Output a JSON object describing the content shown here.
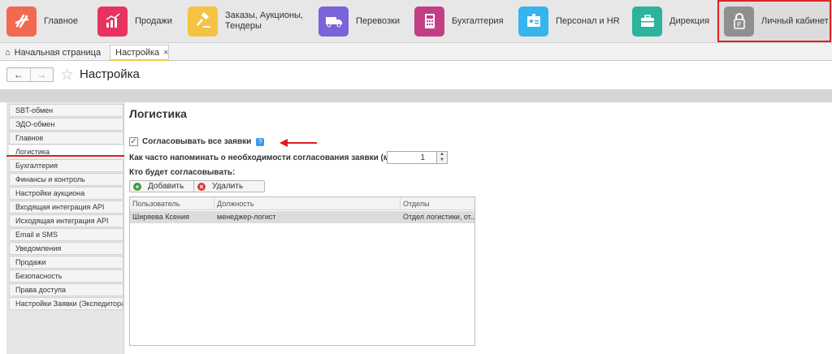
{
  "modules": [
    {
      "label": "Главное",
      "icon": "scribble-logo-icon",
      "color": "#f16a4f"
    },
    {
      "label": "Продажи",
      "icon": "sales-chart-icon",
      "color": "#e8325f"
    },
    {
      "label": "Заказы,  Аукционы,\nТендеры",
      "icon": "gavel-icon",
      "color": "#f5c342"
    },
    {
      "label": "Перевозки",
      "icon": "truck-icon",
      "color": "#7b63d9"
    },
    {
      "label": "Бухгалтерия",
      "icon": "calculator-icon",
      "color": "#c23f86"
    },
    {
      "label": "Персонал и HR",
      "icon": "id-card-icon",
      "color": "#35b4ee"
    },
    {
      "label": "Дирекция",
      "icon": "briefcase-icon",
      "color": "#2eb39a"
    },
    {
      "label": "Личный кабинет",
      "icon": "lock-icon",
      "color": "#8f8f8f"
    }
  ],
  "tabs": {
    "home": "Начальная страница",
    "settings": "Настройка",
    "close": "×"
  },
  "page_title": "Настройка",
  "sidebar": {
    "items": [
      "SBT-обмен",
      "ЭДО-обмен",
      "Главное",
      "Логистика",
      "Бухгалтерия",
      "Финансы и контроль",
      "Настройки аукциона",
      "Входящая интеграция API",
      "Исходящая интеграция API",
      "Email и SMS",
      "Уведомления",
      "Продажи",
      "Безопасность",
      "Права доступа",
      "Настройки Заявки (Экспедитора)"
    ],
    "active_index": 3
  },
  "section": {
    "title": "Логистика",
    "approve_all_label": "Согласовывать все заявки",
    "approve_all_checked": true,
    "remind_label": "Как часто напоминать о необходимости согласования заявки (мин):",
    "remind_value": "1",
    "who_label": "Кто будет согласовывать:",
    "add_button": "Добавить",
    "delete_button": "Удалить"
  },
  "table": {
    "columns": [
      "Пользователь",
      "Должность",
      "Отделы"
    ],
    "rows": [
      [
        "Ширяева Ксения",
        "менеджер-логист",
        "Отдел логистики, от..."
      ]
    ]
  }
}
